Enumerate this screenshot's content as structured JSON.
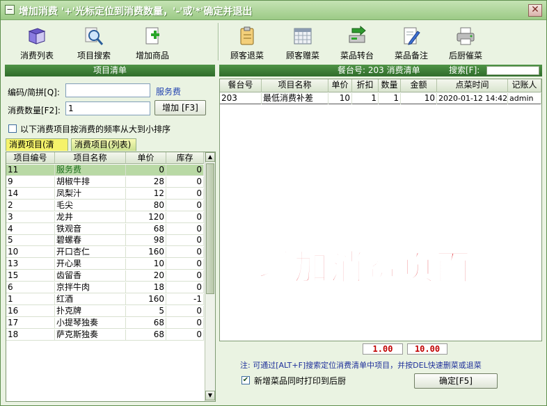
{
  "window": {
    "title": "增加消费  '+'光标定位到消费数量，'-'或'*'确定并退出",
    "close_glyph": "✕"
  },
  "toolbar": [
    {
      "label": "消费列表",
      "icon": "book-icon"
    },
    {
      "label": "项目搜索",
      "icon": "magnifier-icon"
    },
    {
      "label": "增加商品",
      "icon": "add-document-icon"
    },
    {
      "label": "顾客退菜",
      "icon": "clipboard-icon"
    },
    {
      "label": "顾客赠菜",
      "icon": "calendar-icon"
    },
    {
      "label": "菜品转台",
      "icon": "transfer-icon"
    },
    {
      "label": "菜品备注",
      "icon": "note-pencil-icon"
    },
    {
      "label": "后厨催菜",
      "icon": "printer-icon"
    }
  ],
  "left": {
    "header": "项目清单",
    "code_label": "编码/简拼[Q]:",
    "code_value": "",
    "service_link": "服务费",
    "qty_label": "消费数量[F2]:",
    "qty_value": "1",
    "add_button": "增加 [F3]",
    "sort_checkbox_label": "以下消费项目按消费的频率从大到小排序",
    "tabs": [
      "消费项目(清单)",
      "消费项目(列表)"
    ],
    "columns": [
      "项目编号",
      "项目名称",
      "单价",
      "库存"
    ],
    "rows": [
      [
        "11",
        "服务费",
        "0",
        "0"
      ],
      [
        "9",
        "胡椒牛排",
        "28",
        "0"
      ],
      [
        "14",
        "凤梨汁",
        "12",
        "0"
      ],
      [
        "2",
        "毛尖",
        "80",
        "0"
      ],
      [
        "3",
        "龙井",
        "120",
        "0"
      ],
      [
        "4",
        "铁观音",
        "68",
        "0"
      ],
      [
        "5",
        "碧螺春",
        "98",
        "0"
      ],
      [
        "10",
        "开口杏仁",
        "160",
        "0"
      ],
      [
        "13",
        "开心果",
        "10",
        "0"
      ],
      [
        "15",
        "齿留香",
        "20",
        "0"
      ],
      [
        "6",
        "京拌牛肉",
        "18",
        "0"
      ],
      [
        "1",
        "红酒",
        "160",
        "-1"
      ],
      [
        "16",
        "扑克牌",
        "5",
        "0"
      ],
      [
        "17",
        "小提琴独奏",
        "68",
        "0"
      ],
      [
        "18",
        "萨克斯独奏",
        "68",
        "0"
      ]
    ]
  },
  "right": {
    "header_title": "餐台号: 203 消费清单",
    "search_label": "搜索[F]:",
    "columns": [
      "餐台号",
      "项目名称",
      "单价",
      "折扣",
      "数量",
      "金额",
      "点菜时间",
      "记账人"
    ],
    "rows": [
      [
        "203",
        "最低消费补差",
        "10",
        "1",
        "1",
        "10",
        "2020-01-12 14:42",
        "admin"
      ]
    ],
    "watermark": "增加消费页面",
    "sum_qty": "1.00",
    "sum_amount": "10.00",
    "note": "注: 可通过[ALT+F]搜索定位消费清单中项目，并按DEL快速删菜或退菜",
    "print_checkbox_label": "新增菜品同时打印到后厨",
    "print_checked": true,
    "confirm_button": "确定[F5]"
  }
}
